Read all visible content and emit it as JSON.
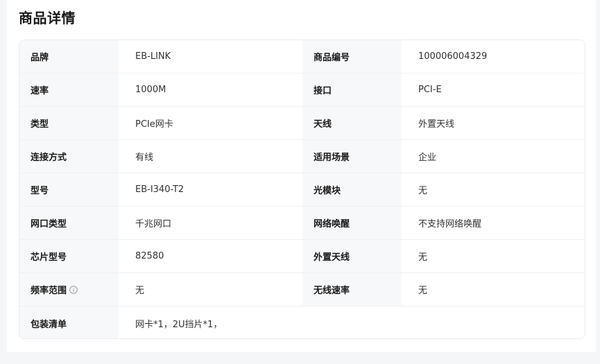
{
  "page": {
    "title": "商品详情"
  },
  "specs": [
    {
      "label1": "品牌",
      "value1": "EB-LINK",
      "label2": "商品编号",
      "value2": "100006004329"
    },
    {
      "label1": "速率",
      "value1": "1000M",
      "label2": "接口",
      "value2": "PCI-E"
    },
    {
      "label1": "类型",
      "value1": "PCIe网卡",
      "label2": "天线",
      "value2": "外置天线"
    },
    {
      "label1": "连接方式",
      "value1": "有线",
      "label2": "适用场景",
      "value2": "企业"
    },
    {
      "label1": "型号",
      "value1": "EB-I340-T2",
      "label2": "光模块",
      "value2": "无"
    },
    {
      "label1": "网口类型",
      "value1": "千兆网口",
      "label2": "网络唤醒",
      "value2": "不支持网络唤醒"
    },
    {
      "label1": "芯片型号",
      "value1": "82580",
      "label2": "外置天线",
      "value2": "无"
    },
    {
      "label1": "频率范围",
      "value1": "无",
      "label2": "无线速率",
      "value2": "无",
      "label1_icon": "info-circle-icon"
    },
    {
      "label1": "包装清单",
      "value1": "网卡*1，2U挡片*1，"
    }
  ],
  "colors": {
    "label_bg": "#f7f8fa",
    "border": "#e9ebef",
    "text": "#1a1a1a",
    "value_text": "#333333",
    "icon_gray": "#999999"
  }
}
